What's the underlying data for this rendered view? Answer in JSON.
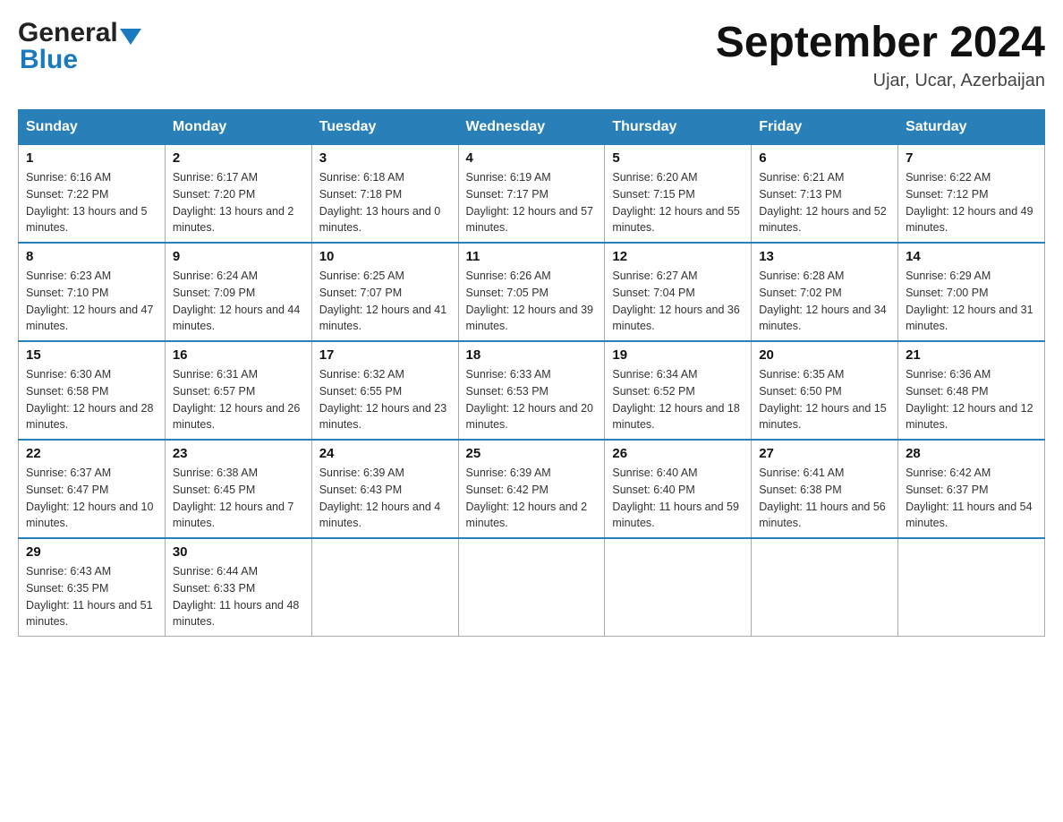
{
  "header": {
    "logo_general": "General",
    "logo_blue": "Blue",
    "main_title": "September 2024",
    "subtitle": "Ujar, Ucar, Azerbaijan"
  },
  "calendar": {
    "days_of_week": [
      "Sunday",
      "Monday",
      "Tuesday",
      "Wednesday",
      "Thursday",
      "Friday",
      "Saturday"
    ],
    "weeks": [
      [
        {
          "day": "1",
          "sunrise": "Sunrise: 6:16 AM",
          "sunset": "Sunset: 7:22 PM",
          "daylight": "Daylight: 13 hours and 5 minutes."
        },
        {
          "day": "2",
          "sunrise": "Sunrise: 6:17 AM",
          "sunset": "Sunset: 7:20 PM",
          "daylight": "Daylight: 13 hours and 2 minutes."
        },
        {
          "day": "3",
          "sunrise": "Sunrise: 6:18 AM",
          "sunset": "Sunset: 7:18 PM",
          "daylight": "Daylight: 13 hours and 0 minutes."
        },
        {
          "day": "4",
          "sunrise": "Sunrise: 6:19 AM",
          "sunset": "Sunset: 7:17 PM",
          "daylight": "Daylight: 12 hours and 57 minutes."
        },
        {
          "day": "5",
          "sunrise": "Sunrise: 6:20 AM",
          "sunset": "Sunset: 7:15 PM",
          "daylight": "Daylight: 12 hours and 55 minutes."
        },
        {
          "day": "6",
          "sunrise": "Sunrise: 6:21 AM",
          "sunset": "Sunset: 7:13 PM",
          "daylight": "Daylight: 12 hours and 52 minutes."
        },
        {
          "day": "7",
          "sunrise": "Sunrise: 6:22 AM",
          "sunset": "Sunset: 7:12 PM",
          "daylight": "Daylight: 12 hours and 49 minutes."
        }
      ],
      [
        {
          "day": "8",
          "sunrise": "Sunrise: 6:23 AM",
          "sunset": "Sunset: 7:10 PM",
          "daylight": "Daylight: 12 hours and 47 minutes."
        },
        {
          "day": "9",
          "sunrise": "Sunrise: 6:24 AM",
          "sunset": "Sunset: 7:09 PM",
          "daylight": "Daylight: 12 hours and 44 minutes."
        },
        {
          "day": "10",
          "sunrise": "Sunrise: 6:25 AM",
          "sunset": "Sunset: 7:07 PM",
          "daylight": "Daylight: 12 hours and 41 minutes."
        },
        {
          "day": "11",
          "sunrise": "Sunrise: 6:26 AM",
          "sunset": "Sunset: 7:05 PM",
          "daylight": "Daylight: 12 hours and 39 minutes."
        },
        {
          "day": "12",
          "sunrise": "Sunrise: 6:27 AM",
          "sunset": "Sunset: 7:04 PM",
          "daylight": "Daylight: 12 hours and 36 minutes."
        },
        {
          "day": "13",
          "sunrise": "Sunrise: 6:28 AM",
          "sunset": "Sunset: 7:02 PM",
          "daylight": "Daylight: 12 hours and 34 minutes."
        },
        {
          "day": "14",
          "sunrise": "Sunrise: 6:29 AM",
          "sunset": "Sunset: 7:00 PM",
          "daylight": "Daylight: 12 hours and 31 minutes."
        }
      ],
      [
        {
          "day": "15",
          "sunrise": "Sunrise: 6:30 AM",
          "sunset": "Sunset: 6:58 PM",
          "daylight": "Daylight: 12 hours and 28 minutes."
        },
        {
          "day": "16",
          "sunrise": "Sunrise: 6:31 AM",
          "sunset": "Sunset: 6:57 PM",
          "daylight": "Daylight: 12 hours and 26 minutes."
        },
        {
          "day": "17",
          "sunrise": "Sunrise: 6:32 AM",
          "sunset": "Sunset: 6:55 PM",
          "daylight": "Daylight: 12 hours and 23 minutes."
        },
        {
          "day": "18",
          "sunrise": "Sunrise: 6:33 AM",
          "sunset": "Sunset: 6:53 PM",
          "daylight": "Daylight: 12 hours and 20 minutes."
        },
        {
          "day": "19",
          "sunrise": "Sunrise: 6:34 AM",
          "sunset": "Sunset: 6:52 PM",
          "daylight": "Daylight: 12 hours and 18 minutes."
        },
        {
          "day": "20",
          "sunrise": "Sunrise: 6:35 AM",
          "sunset": "Sunset: 6:50 PM",
          "daylight": "Daylight: 12 hours and 15 minutes."
        },
        {
          "day": "21",
          "sunrise": "Sunrise: 6:36 AM",
          "sunset": "Sunset: 6:48 PM",
          "daylight": "Daylight: 12 hours and 12 minutes."
        }
      ],
      [
        {
          "day": "22",
          "sunrise": "Sunrise: 6:37 AM",
          "sunset": "Sunset: 6:47 PM",
          "daylight": "Daylight: 12 hours and 10 minutes."
        },
        {
          "day": "23",
          "sunrise": "Sunrise: 6:38 AM",
          "sunset": "Sunset: 6:45 PM",
          "daylight": "Daylight: 12 hours and 7 minutes."
        },
        {
          "day": "24",
          "sunrise": "Sunrise: 6:39 AM",
          "sunset": "Sunset: 6:43 PM",
          "daylight": "Daylight: 12 hours and 4 minutes."
        },
        {
          "day": "25",
          "sunrise": "Sunrise: 6:39 AM",
          "sunset": "Sunset: 6:42 PM",
          "daylight": "Daylight: 12 hours and 2 minutes."
        },
        {
          "day": "26",
          "sunrise": "Sunrise: 6:40 AM",
          "sunset": "Sunset: 6:40 PM",
          "daylight": "Daylight: 11 hours and 59 minutes."
        },
        {
          "day": "27",
          "sunrise": "Sunrise: 6:41 AM",
          "sunset": "Sunset: 6:38 PM",
          "daylight": "Daylight: 11 hours and 56 minutes."
        },
        {
          "day": "28",
          "sunrise": "Sunrise: 6:42 AM",
          "sunset": "Sunset: 6:37 PM",
          "daylight": "Daylight: 11 hours and 54 minutes."
        }
      ],
      [
        {
          "day": "29",
          "sunrise": "Sunrise: 6:43 AM",
          "sunset": "Sunset: 6:35 PM",
          "daylight": "Daylight: 11 hours and 51 minutes."
        },
        {
          "day": "30",
          "sunrise": "Sunrise: 6:44 AM",
          "sunset": "Sunset: 6:33 PM",
          "daylight": "Daylight: 11 hours and 48 minutes."
        },
        null,
        null,
        null,
        null,
        null
      ]
    ]
  }
}
